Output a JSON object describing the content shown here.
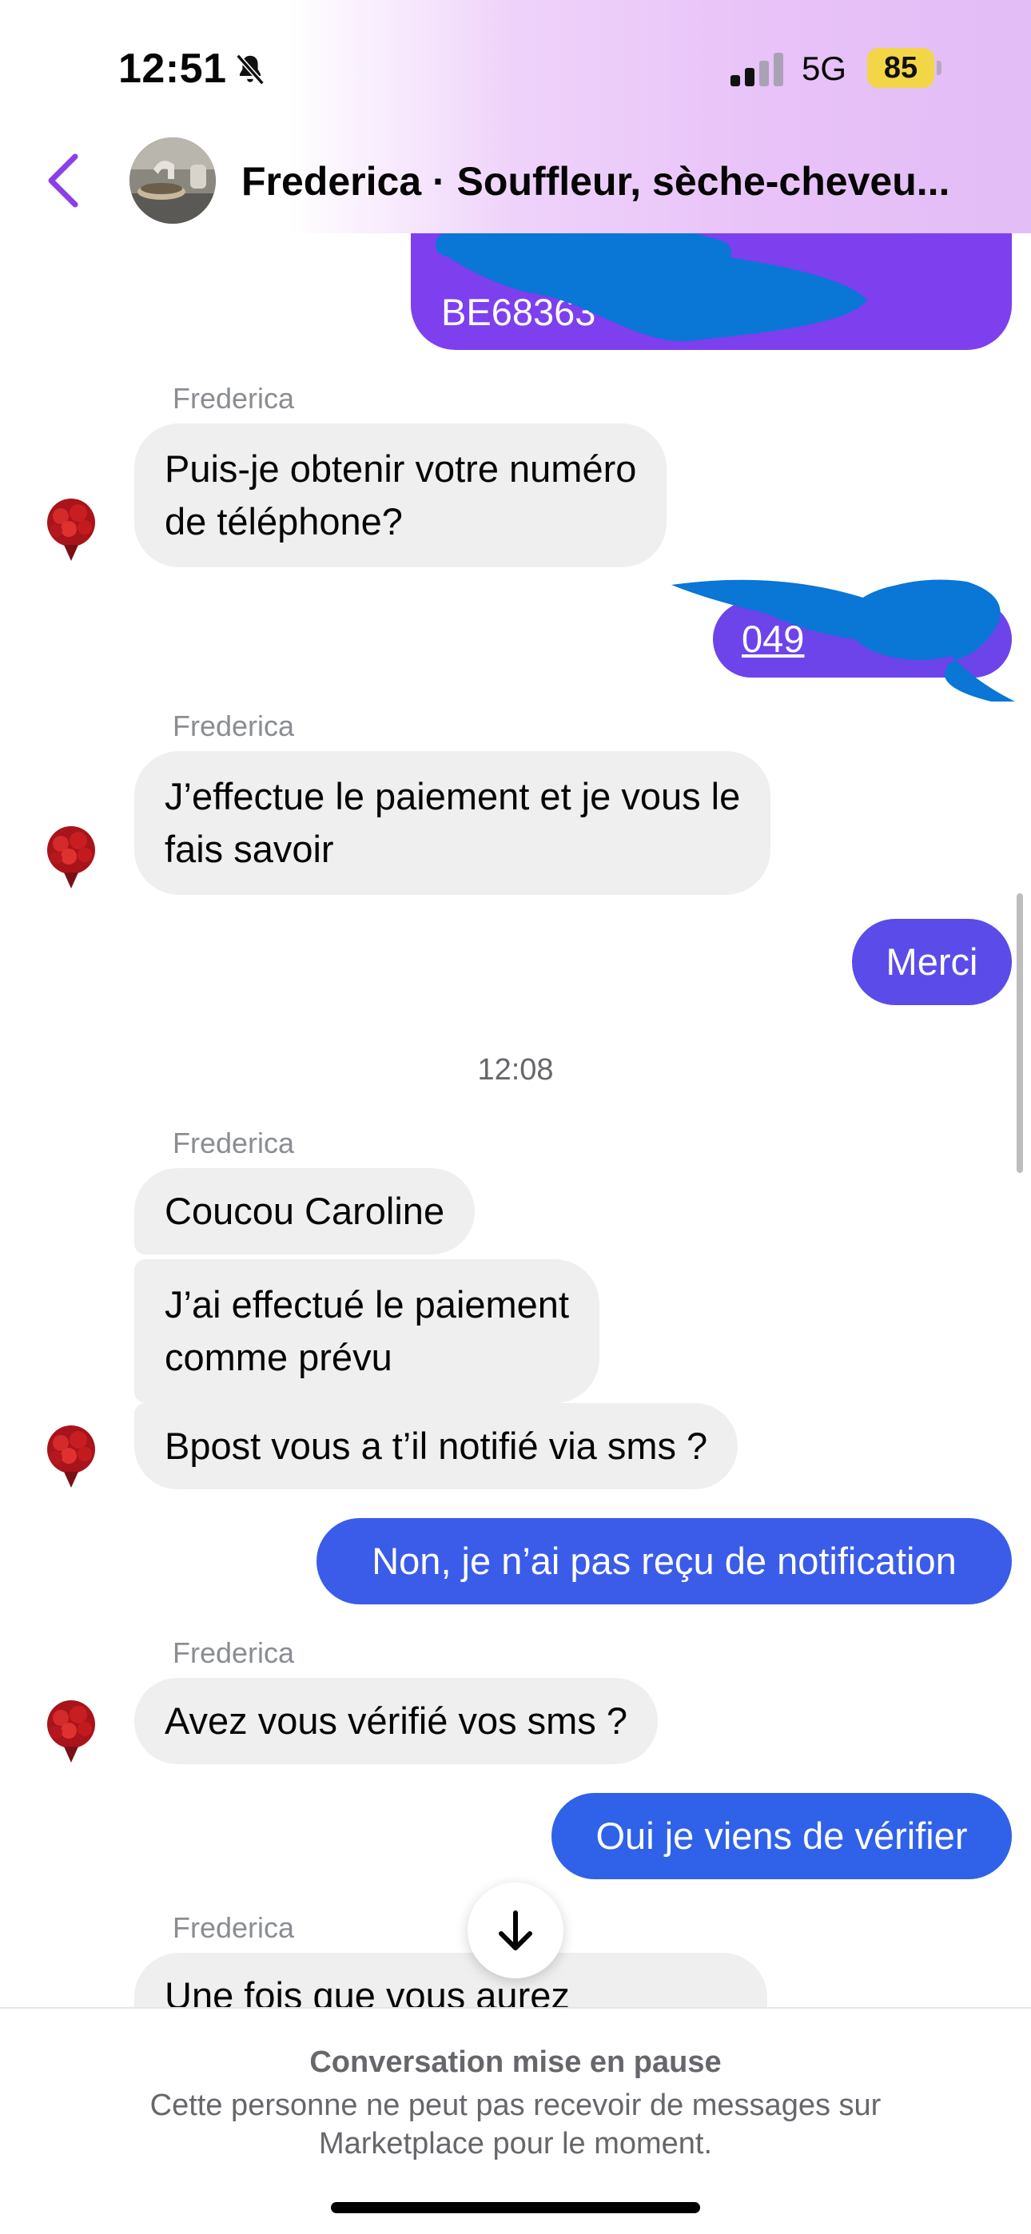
{
  "status_bar": {
    "time": "12:51",
    "network": "5G",
    "battery": "85",
    "icons": [
      "bell-slash-icon",
      "signal-icon"
    ]
  },
  "header": {
    "title": "Frederica · Souffleur, sèche-cheveu...",
    "back_icon": "chevron-left-icon",
    "accent_color": "#8b3fe6"
  },
  "messages": [
    {
      "type": "outgoing",
      "text": "BE68363",
      "color": "#7e3fee",
      "redacted": true
    },
    {
      "type": "incoming",
      "sender": "Frederica",
      "text_lines": [
        "Puis-je obtenir votre numéro",
        "de téléphone?"
      ]
    },
    {
      "type": "outgoing",
      "text": "049",
      "color": "#6d44ea",
      "redacted": true,
      "underlined": true
    },
    {
      "type": "incoming",
      "sender": "Frederica",
      "text_lines": [
        "J’effectue le paiement et je vous le",
        "fais savoir"
      ]
    },
    {
      "type": "outgoing",
      "text": "Merci",
      "color": "#5b4be8"
    },
    {
      "type": "timestamp",
      "text": "12:08"
    },
    {
      "type": "incoming",
      "sender": "Frederica",
      "text": "Coucou Caroline"
    },
    {
      "type": "incoming",
      "text_lines": [
        "J’ai effectué le paiement",
        "comme prévu"
      ]
    },
    {
      "type": "incoming",
      "text": "Bpost vous a t’il notifié via sms ?"
    },
    {
      "type": "outgoing",
      "text": "Non, je n’ai pas reçu de notification",
      "color": "#3b5ce8"
    },
    {
      "type": "incoming",
      "sender": "Frederica",
      "text": "Avez vous vérifié vos sms ?"
    },
    {
      "type": "outgoing",
      "text": "Oui je viens de vérifier",
      "color": "#2f62e8"
    },
    {
      "type": "incoming",
      "sender": "Frederica",
      "text": "Une fois que vous aurez"
    }
  ],
  "footer": {
    "title": "Conversation mise en pause",
    "text_line1": "Cette personne ne peut pas recevoir de messages sur",
    "text_line2": "Marketplace pour le moment."
  }
}
